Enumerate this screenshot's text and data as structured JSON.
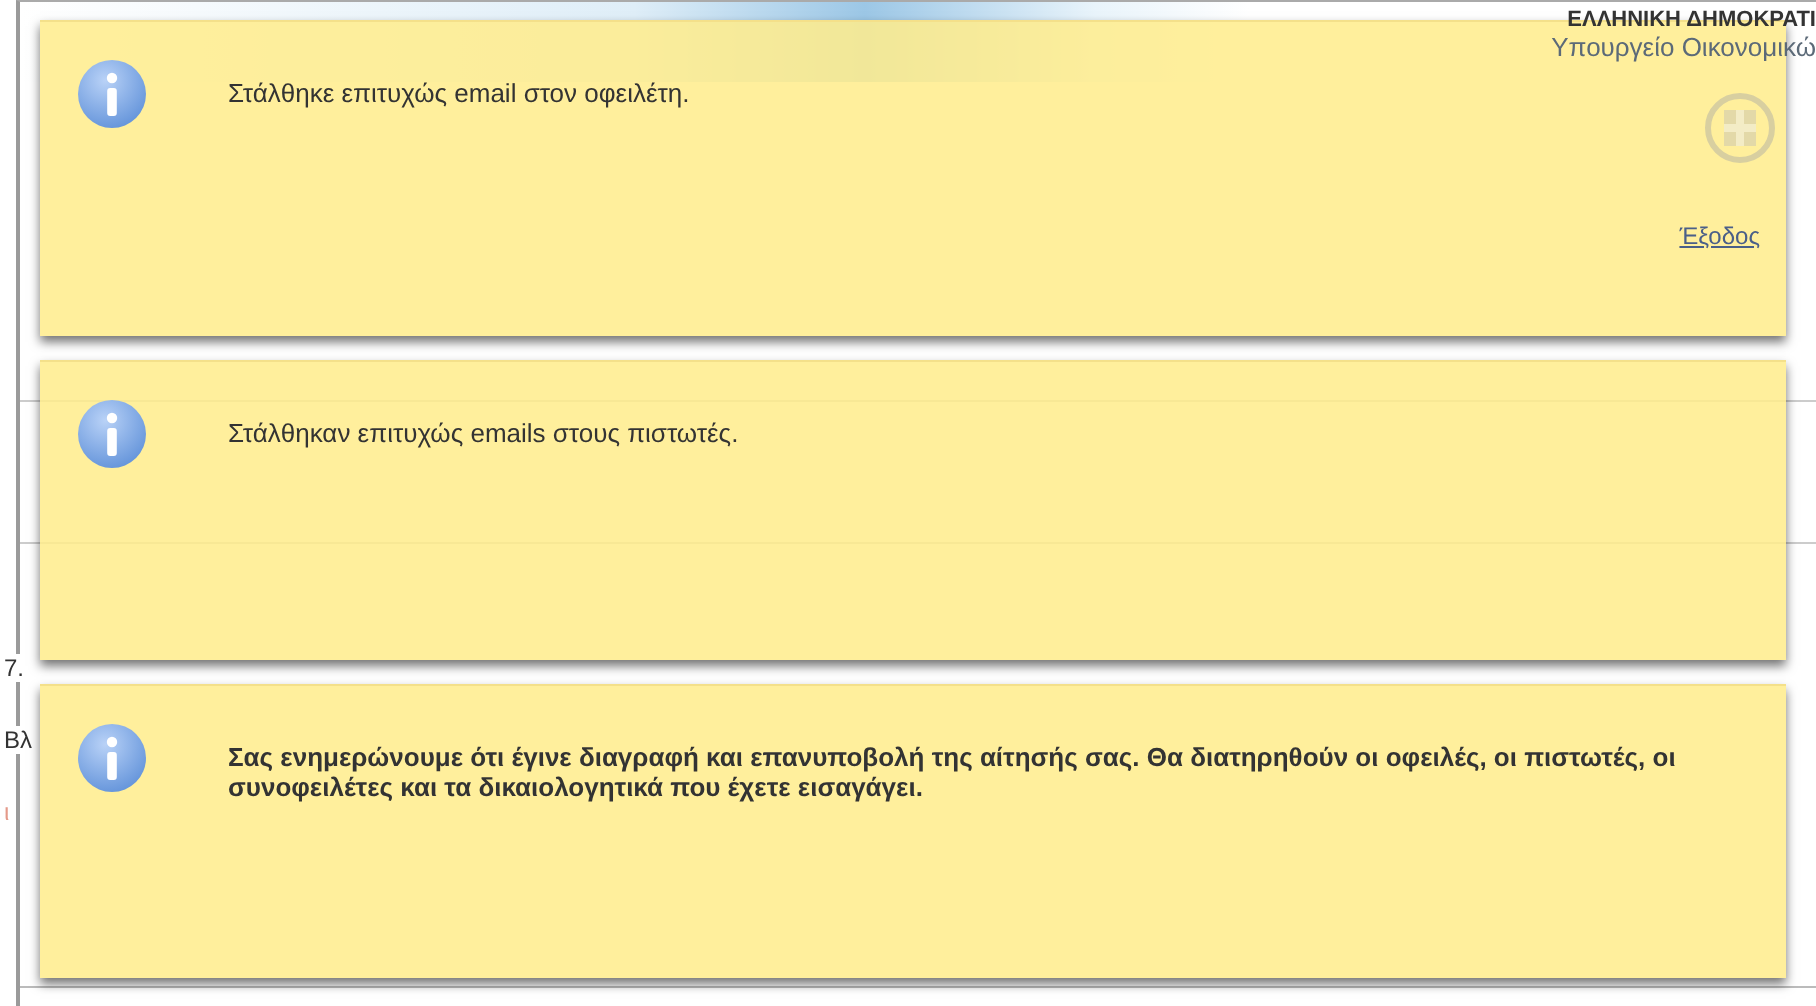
{
  "page": {
    "header": {
      "title": "ΕΛΛΗΝΙΚΗ ΔΗΜΟΚΡΑΤΙ",
      "subtitle": "Υπουργείο Οικονομικώ",
      "logout": "Έξοδος"
    },
    "body_lines": [
      {
        "text": "7.",
        "kind": "plain"
      },
      {
        "text": "Βλ",
        "kind": "plain"
      },
      {
        "text": "ι",
        "kind": "alert"
      }
    ]
  },
  "notifications": [
    {
      "message": "Στάλθηκε επιτυχώς email στον οφειλέτη.",
      "bold": false
    },
    {
      "message": "Στάλθηκαν επιτυχώς emails στους πιστωτές.",
      "bold": false
    },
    {
      "message": "Σας ενημερώνουμε ότι έγινε διαγραφή και επανυποβολή της αίτησής σας. Θα διατηρηθούν οι οφειλές, οι πιστωτές, οι συνοφειλέτες και τα δικαιολογητικά που έχετε εισαγάγει.",
      "bold": true
    }
  ]
}
